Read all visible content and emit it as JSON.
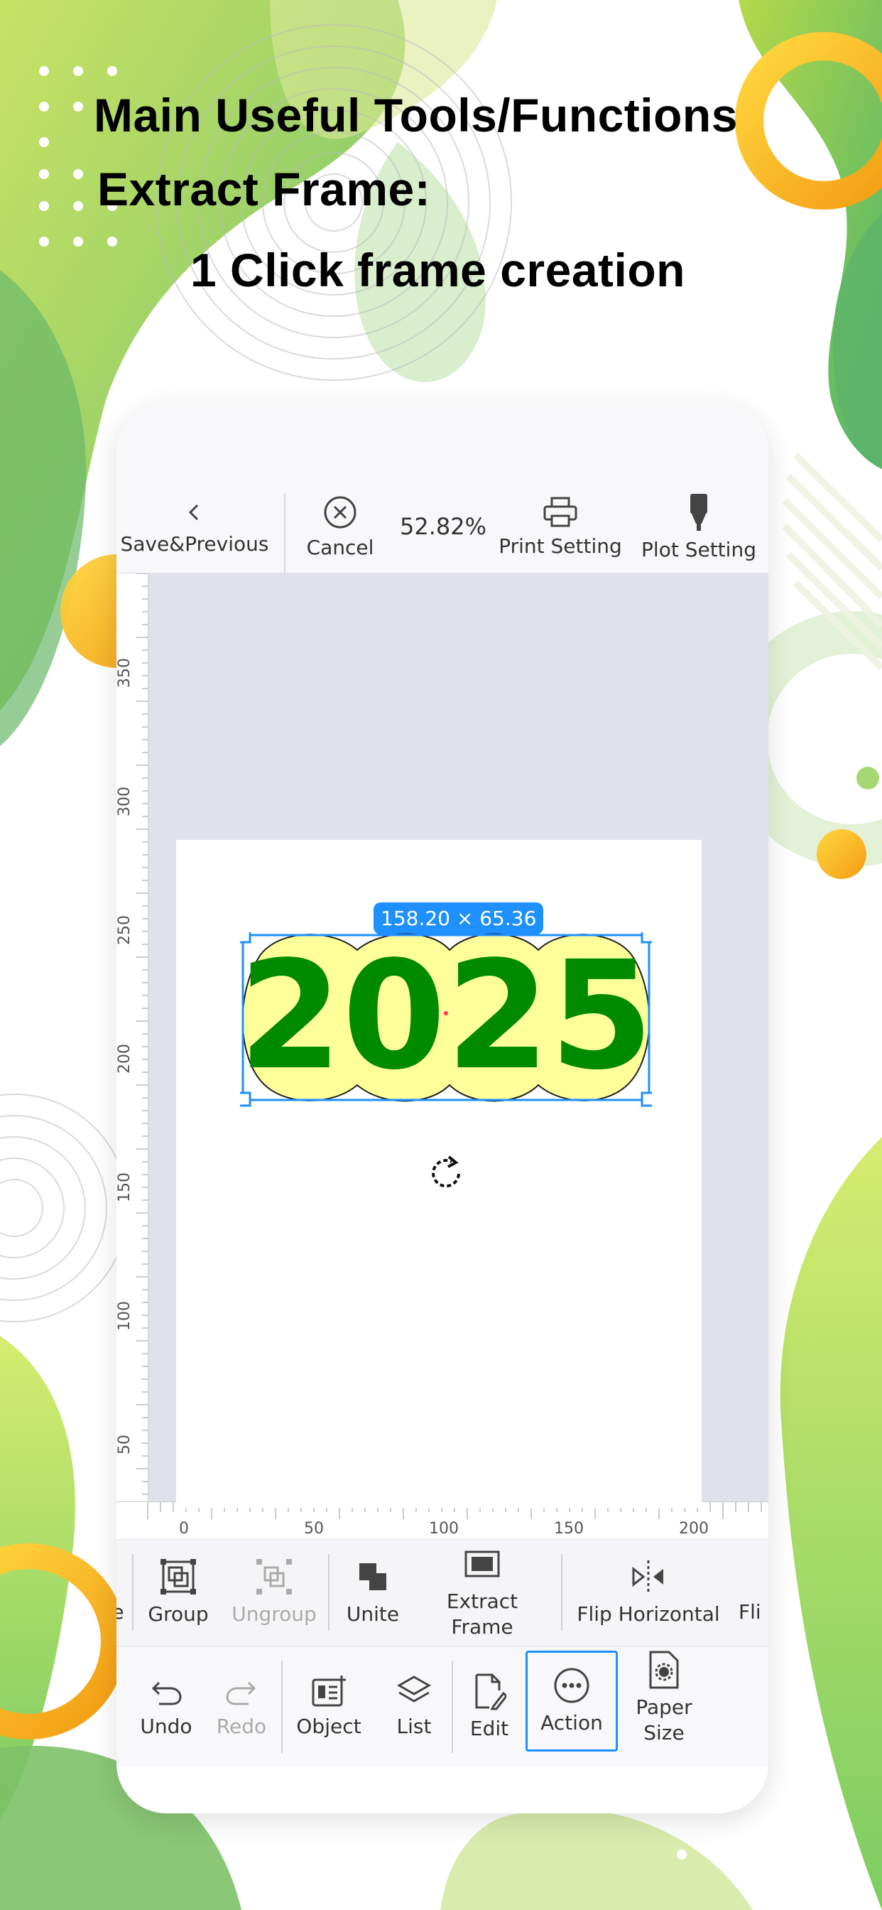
{
  "headline": {
    "line1": "Main Useful Tools/Functions",
    "line2": "Extract Frame:",
    "line3": "1 Click frame creation"
  },
  "toolbar": {
    "back_label": "Save&Previous",
    "cancel_label": "Cancel",
    "zoom": "52.82%",
    "print_label": "Print Setting",
    "plot_label": "Plot Setting"
  },
  "rulers": {
    "vertical": [
      "350",
      "300",
      "250",
      "200",
      "150",
      "100",
      "50"
    ],
    "horizontal": [
      "0",
      "50",
      "100",
      "150",
      "200"
    ]
  },
  "selection": {
    "size_label": "158.20 × 65.36",
    "text": "2025"
  },
  "tool_row": [
    {
      "label": "e",
      "icon": "unknown-cut-icon",
      "enabled": true
    },
    {
      "label": "Group",
      "icon": "group-icon",
      "enabled": true
    },
    {
      "label": "Ungroup",
      "icon": "ungroup-icon",
      "enabled": false
    },
    {
      "label": "Unite",
      "icon": "unite-icon",
      "enabled": true
    },
    {
      "label": "Extract Frame",
      "icon": "extract-frame-icon",
      "enabled": true
    },
    {
      "label": "Flip Horizontal",
      "icon": "flip-horizontal-icon",
      "enabled": true
    },
    {
      "label": "Fli",
      "icon": "flip-vertical-icon",
      "enabled": true
    }
  ],
  "bottom_nav": [
    {
      "label": "Undo",
      "icon": "undo-icon",
      "enabled": true
    },
    {
      "label": "Redo",
      "icon": "redo-icon",
      "enabled": false
    },
    {
      "label": "Object",
      "icon": "object-icon",
      "enabled": true
    },
    {
      "label": "List",
      "icon": "layers-icon",
      "enabled": true
    },
    {
      "label": "Edit",
      "icon": "edit-icon",
      "enabled": true
    },
    {
      "label": "Action",
      "icon": "more-icon",
      "enabled": true,
      "active": true
    },
    {
      "label": "Paper Size",
      "icon": "paper-settings-icon",
      "enabled": true
    }
  ],
  "colors": {
    "accent": "#1e90ff",
    "canvas_bg": "#dfe2ea",
    "text_fill": "#008a00",
    "frame_fill": "#ffff99",
    "bg_green": "#8cc63f",
    "bg_yellow": "#f7c21e"
  }
}
